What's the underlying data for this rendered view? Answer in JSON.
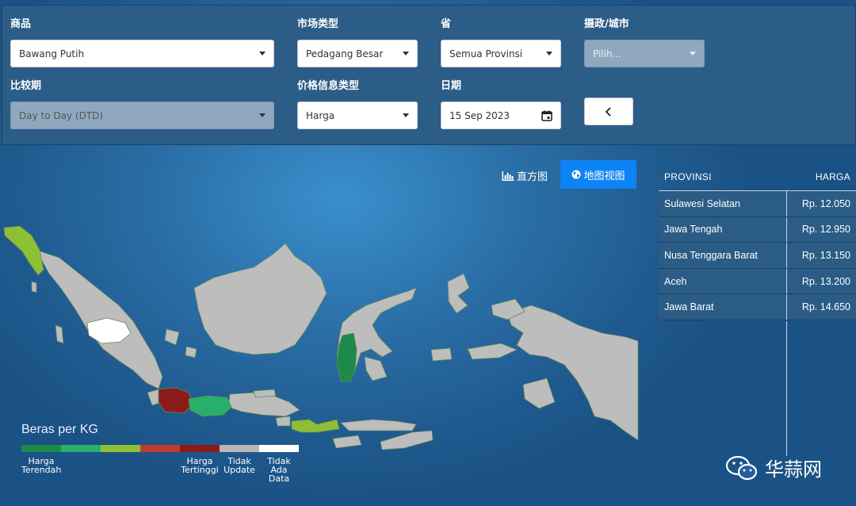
{
  "filters": {
    "commodity": {
      "label": "商品",
      "value": "Bawang Putih"
    },
    "market_type": {
      "label": "市场类型",
      "value": "Pedagang Besar"
    },
    "province": {
      "label": "省",
      "value": "Semua Provinsi"
    },
    "regency": {
      "label": "摄政/城市",
      "placeholder": "Pilih..."
    },
    "comparison": {
      "label": "比较期",
      "value": "Day to Day (DTD)"
    },
    "price_info_type": {
      "label": "价格信息类型",
      "value": "Harga"
    },
    "date": {
      "label": "日期",
      "value": "15 Sep 2023"
    }
  },
  "view_toggle": {
    "histogram": "直方图",
    "map": "地图视图"
  },
  "icons": {
    "histogram": "bar-chart-icon",
    "map": "globe-icon",
    "date": "calendar-icon",
    "back": "chevron-left-icon",
    "watermark": "wechat-icon"
  },
  "legend": {
    "title": "Beras per KG",
    "colors": [
      "#1e8a4a",
      "#27b06a",
      "#8fbf35",
      "#c0392b",
      "#8b1a1a",
      "#b9b9b9",
      "#ffffff"
    ],
    "labels": {
      "lowest_1": "Harga",
      "lowest_2": "Terendah",
      "highest_1": "Harga",
      "highest_2": "Tertinggi",
      "no_update_1": "Tidak",
      "no_update_2": "Update",
      "no_data_1": "Tidak",
      "no_data_2": "Ada Data"
    }
  },
  "map_colors": {
    "base": "#bdbdbd",
    "border": "#5e8a5a",
    "aceh": "#8fbf35",
    "west_java": "#8b1a1a",
    "central_java": "#27b06a",
    "south_sulawesi": "#1e8a4a",
    "ntb": "#8fbf35",
    "no_data": "#ffffff"
  },
  "table": {
    "header_province": "PROVINSI",
    "header_price": "HARGA",
    "rows": [
      {
        "province": "Sulawesi Selatan",
        "price": "Rp. 12.050"
      },
      {
        "province": "Jawa Tengah",
        "price": "Rp. 12.950"
      },
      {
        "province": "Nusa Tenggara Barat",
        "price": "Rp. 13.150"
      },
      {
        "province": "Aceh",
        "price": "Rp. 13.200"
      },
      {
        "province": "Jawa Barat",
        "price": "Rp. 14.650"
      }
    ]
  },
  "watermark": "华蒜网"
}
